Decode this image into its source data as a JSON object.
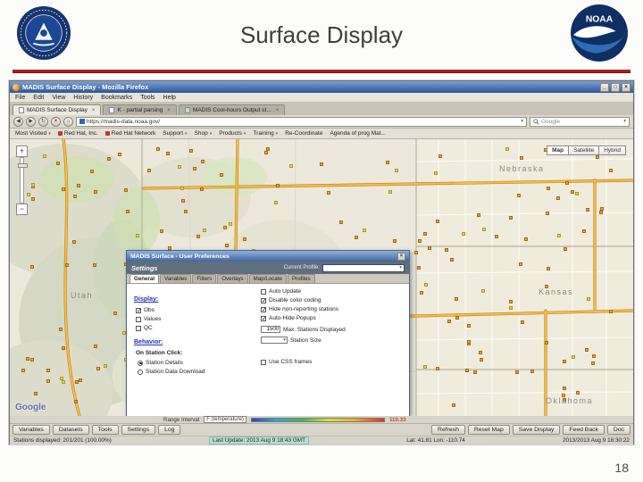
{
  "slide": {
    "title": "Surface Display",
    "page_number": "18"
  },
  "icons": {
    "dropdown": "▾",
    "back": "◀",
    "forward": "▶",
    "reload": "↻",
    "stop": "×",
    "home": "⌂",
    "window_min": "_",
    "window_max": "□",
    "window_close": "×",
    "close": "×",
    "plus": "+",
    "minus": "−",
    "tab_close": "×"
  },
  "logos": {
    "noaa_text": "NOAA"
  },
  "browser": {
    "window_title": "MADIS Surface Display - Mozilla Firefox",
    "menu_items": [
      "File",
      "Edit",
      "View",
      "History",
      "Bookmarks",
      "Tools",
      "Help"
    ],
    "tabs": [
      {
        "label": "MADIS Surface Display"
      },
      {
        "label": "K - partial parsing"
      },
      {
        "label": "MADIS Cool-hours Output st..."
      }
    ],
    "address_url": "https://madis-data.noaa.gov/",
    "search_value": "Google",
    "bookmarks": [
      "Most Visited",
      "Red Hat, Inc.",
      "Red Hat Network",
      "Support",
      "Shop",
      "Products",
      "Training",
      "Re-Coordinate",
      "Agenda of prog Mat..."
    ]
  },
  "map": {
    "type_buttons": [
      "Map",
      "Satellite",
      "Hybrid"
    ],
    "states": [
      {
        "label": "Utah"
      },
      {
        "label": "Nebraska"
      },
      {
        "label": "Kansas"
      },
      {
        "label": "Oklahoma"
      }
    ],
    "attribution": "Google",
    "station_count": 201
  },
  "dialog": {
    "title": "MADIS Surface - User Preferences",
    "section": "Settings",
    "profile_label": "Current Profile:",
    "tabs": [
      "General",
      "Variables",
      "Filters",
      "Overlays",
      "Map/Locate",
      "Profiles"
    ],
    "options_right": [
      {
        "label": "Auto Update",
        "checked": false
      },
      {
        "label": "Disable color coding",
        "checked": true
      },
      {
        "label": "Hide non-reporting stations",
        "checked": true
      },
      {
        "label": "Auto-Hide Popups",
        "checked": true
      }
    ],
    "max_stations": {
      "value": "1500",
      "label": "Max. Stations Displayed"
    },
    "station_size_label": "Station Size",
    "use_css_frames": {
      "label": "Use CSS frames",
      "checked": false
    },
    "display": {
      "heading": "Display:",
      "options": [
        {
          "label": "Obs",
          "checked": true
        },
        {
          "label": "Values",
          "checked": false
        },
        {
          "label": "QC",
          "checked": false
        }
      ]
    },
    "behavior": {
      "heading": "Behavior:",
      "subheading": "On Station Click:",
      "options": [
        {
          "label": "Station Details",
          "selected": true
        },
        {
          "label": "Station Data Download",
          "selected": false
        }
      ]
    }
  },
  "range": {
    "label": "Range Interval",
    "units": "F (temperature)",
    "max_value": "110.33"
  },
  "toolbar": {
    "left": [
      "Variables",
      "Datasets",
      "Tools",
      "Settings",
      "Log"
    ],
    "right": [
      "Refresh",
      "Reset Map",
      "Save Display",
      "Feed Back",
      "Doc"
    ]
  },
  "status": {
    "stations": "Stations displayed:  201/201  (100.00%)",
    "last_update": "Last Update: 2013 Aug 9 18:43 GMT",
    "coords": "Lat: 41.81   Lon: -110.74",
    "timestamp": "2013/2013 Aug 9 18:30:22"
  }
}
